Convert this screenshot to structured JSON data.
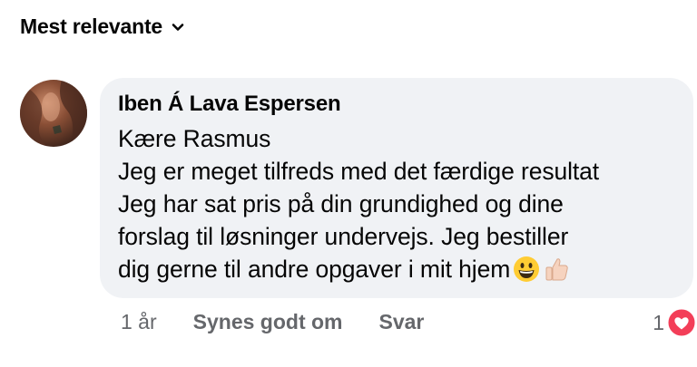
{
  "sort": {
    "label": "Mest relevante",
    "icon": "chevron-down-icon"
  },
  "comment": {
    "author": "Iben Á Lava Espersen",
    "lines": [
      "Kære Rasmus",
      "Jeg er meget tilfreds med det færdige resultat",
      "Jeg har sat pris på din grundighed og dine",
      "forslag til løsninger undervejs. Jeg bestiller",
      "dig gerne til andre opgaver i mit hjem"
    ],
    "emojis": [
      "grinning-face-icon",
      "thumbs-up-icon"
    ],
    "time": "1 år",
    "like_label": "Synes godt om",
    "reply_label": "Svar",
    "reaction_count": "1",
    "reaction_icon": "heart-icon",
    "colors": {
      "bubble": "#f0f2f5",
      "heart": "#f33e58",
      "muted": "#65676b"
    }
  }
}
